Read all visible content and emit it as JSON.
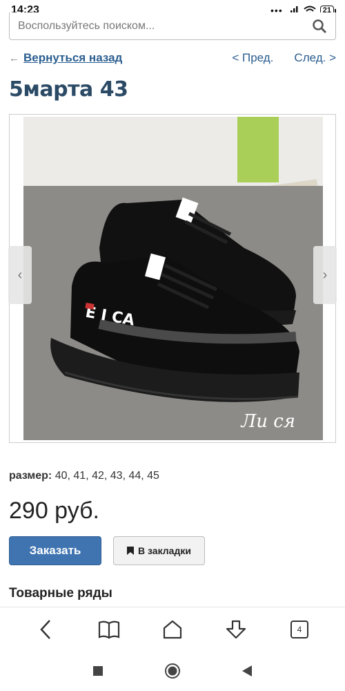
{
  "status_bar": {
    "time": "14:23",
    "signal_dots": "•••",
    "battery": "21"
  },
  "search": {
    "placeholder": "Воспользуйтесь поиском..."
  },
  "nav": {
    "back_arrow": "←",
    "back": "Вернуться назад",
    "prev": "< Пред.",
    "next": "След. >"
  },
  "product": {
    "title": "5марта 43",
    "image_watermark": "Ли ся",
    "size_label": "размер:",
    "sizes": "40, 41, 42, 43, 44, 45",
    "price": "290 руб.",
    "order_button": "Заказать",
    "bookmark_button": "В закладки"
  },
  "gallery": {
    "prev_arrow": "‹",
    "next_arrow": "›"
  },
  "section": {
    "heading": "Товарные ряды"
  },
  "browser_bar": {
    "tabs_count": "4"
  },
  "colors": {
    "link": "#2a5d8f",
    "title": "#2b4a66",
    "primary_button": "#3f74b0"
  }
}
